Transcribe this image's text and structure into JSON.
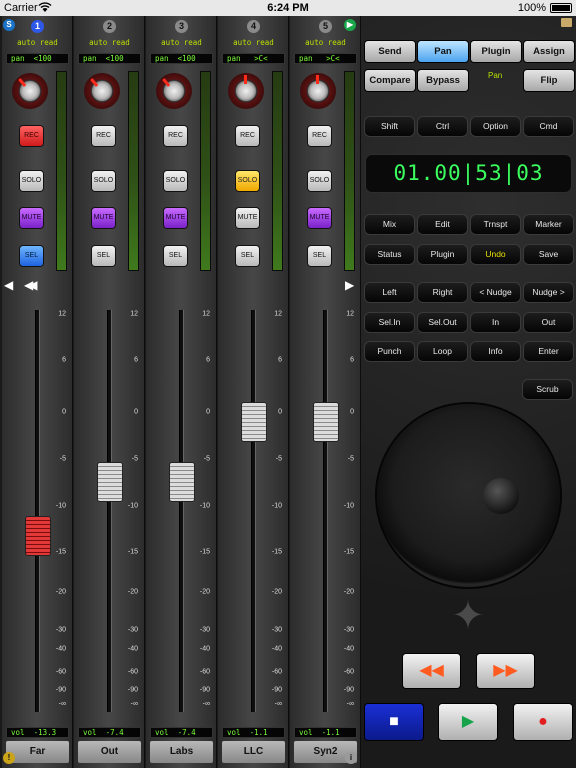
{
  "status": {
    "carrier": "Carrier",
    "time": "6:24 PM",
    "battery": "100%"
  },
  "channels": [
    {
      "num": "1",
      "num_selected": true,
      "auto": "auto read",
      "pan": "pan  <100",
      "knob_angle": -40,
      "rec": "REC",
      "rec_on": true,
      "solo": "SOLO",
      "solo_on": false,
      "mute": "MUTE",
      "mute_on": true,
      "sel": "SEL",
      "sel_on": true,
      "vol": "vol  -13.3",
      "vol_db": -13.3,
      "name": "Far"
    },
    {
      "num": "2",
      "num_selected": false,
      "auto": "auto read",
      "pan": "pan  <100",
      "knob_angle": -40,
      "rec": "REC",
      "rec_on": false,
      "solo": "SOLO",
      "solo_on": false,
      "mute": "MUTE",
      "mute_on": true,
      "sel": "SEL",
      "sel_on": false,
      "vol": "vol  -7.4",
      "vol_db": -7.4,
      "name": "Out"
    },
    {
      "num": "3",
      "num_selected": false,
      "auto": "auto read",
      "pan": "pan  <100",
      "knob_angle": -40,
      "rec": "REC",
      "rec_on": false,
      "solo": "SOLO",
      "solo_on": false,
      "mute": "MUTE",
      "mute_on": true,
      "sel": "SEL",
      "sel_on": false,
      "vol": "vol  -7.4",
      "vol_db": -7.4,
      "name": "Labs"
    },
    {
      "num": "4",
      "num_selected": false,
      "auto": "auto read",
      "pan": "pan   >C<",
      "knob_angle": 0,
      "rec": "REC",
      "rec_on": false,
      "solo": "SOLO",
      "solo_on": true,
      "mute": "MUTE",
      "mute_on": false,
      "sel": "SEL",
      "sel_on": false,
      "vol": "vol  -1.1",
      "vol_db": -1.1,
      "name": "LLC"
    },
    {
      "num": "5",
      "num_selected": false,
      "auto": "auto read",
      "pan": "pan   >C<",
      "knob_angle": 0,
      "rec": "REC",
      "rec_on": false,
      "solo": "SOLO",
      "solo_on": false,
      "mute": "MUTE",
      "mute_on": true,
      "sel": "SEL",
      "sel_on": false,
      "vol": "vol  -1.1",
      "vol_db": -1.1,
      "name": "Syn2"
    }
  ],
  "fader_scale": [
    "12",
    "6",
    "0",
    "-5",
    "-10",
    "-15",
    "-20",
    "-30",
    "-40",
    "-60",
    "-90",
    "-∞"
  ],
  "panel": {
    "top_buttons": [
      {
        "label": "Send",
        "on": false
      },
      {
        "label": "Pan",
        "on": true
      },
      {
        "label": "Plugin",
        "on": false
      },
      {
        "label": "Assign",
        "on": false
      },
      {
        "label": "Compare",
        "on": false
      },
      {
        "label": "Bypass",
        "on": false
      },
      {
        "label": "Flip",
        "on": false
      }
    ],
    "pan_label": "Pan",
    "modifiers": [
      "Shift",
      "Ctrl",
      "Option",
      "Cmd"
    ],
    "counter": "01.00|53|03",
    "keys": [
      {
        "label": "Mix",
        "hl": false
      },
      {
        "label": "Edit",
        "hl": false
      },
      {
        "label": "Trnspt",
        "hl": false
      },
      {
        "label": "Marker",
        "hl": false
      },
      {
        "label": "Status",
        "hl": false
      },
      {
        "label": "Plugin",
        "hl": false
      },
      {
        "label": "Undo",
        "hl": true
      },
      {
        "label": "Save",
        "hl": false
      },
      {
        "label": "Left",
        "hl": false
      },
      {
        "label": "Right",
        "hl": false
      },
      {
        "label": "< Nudge",
        "hl": false
      },
      {
        "label": "Nudge >",
        "hl": false
      },
      {
        "label": "Sel.In",
        "hl": false
      },
      {
        "label": "Sel.Out",
        "hl": false
      },
      {
        "label": "In",
        "hl": false
      },
      {
        "label": "Out",
        "hl": false
      },
      {
        "label": "Punch",
        "hl": false
      },
      {
        "label": "Loop",
        "hl": false
      },
      {
        "label": "Info",
        "hl": false
      },
      {
        "label": "Enter",
        "hl": false
      }
    ],
    "scrub": "Scrub",
    "transport": {
      "rewind": "◀◀",
      "ffwd": "▶▶",
      "stop": "■",
      "play": "▶",
      "record": "●"
    },
    "colors": {
      "stop_bg": "#1a2fd6",
      "play_glyph": "#16a34a",
      "record_glyph": "#e11d1d",
      "rw_ff_glyph": "#ff5a1f"
    }
  }
}
